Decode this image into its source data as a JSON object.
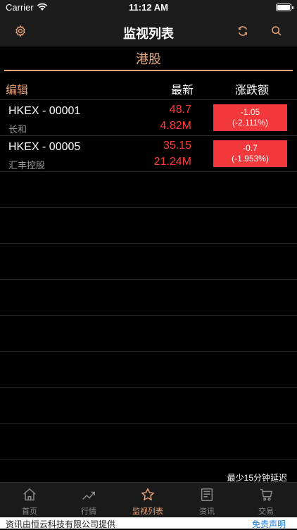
{
  "status": {
    "carrier": "Carrier",
    "time": "11:12 AM"
  },
  "nav": {
    "title": "监视列表",
    "settings_icon": "gear-icon",
    "refresh_icon": "refresh-icon",
    "search_icon": "search-icon"
  },
  "section": {
    "title": "港股"
  },
  "columns": {
    "edit": "编辑",
    "latest": "最新",
    "change": "涨跌额"
  },
  "stocks": [
    {
      "code": "HKEX - 00001",
      "name": "长和",
      "price": "48.7",
      "volume": "4.82M",
      "change": "-1.05",
      "change_pct": "(-2.111%)"
    },
    {
      "code": "HKEX - 00005",
      "name": "汇丰控股",
      "price": "35.15",
      "volume": "21.24M",
      "change": "-0.7",
      "change_pct": "(-1.953%)"
    }
  ],
  "delay_note": "最少15分钟延迟",
  "tabs": [
    {
      "label": "首页",
      "icon": "home-icon"
    },
    {
      "label": "行情",
      "icon": "trend-icon"
    },
    {
      "label": "监视列表",
      "icon": "star-icon",
      "active": true
    },
    {
      "label": "资讯",
      "icon": "news-icon"
    },
    {
      "label": "交易",
      "icon": "cart-icon"
    }
  ],
  "footer": {
    "source": "资讯由恒云科技有限公司提供",
    "disclaimer": "免责声明"
  },
  "colors": {
    "accent": "#e9a679",
    "down": "#f2383a",
    "background": "#000000"
  }
}
